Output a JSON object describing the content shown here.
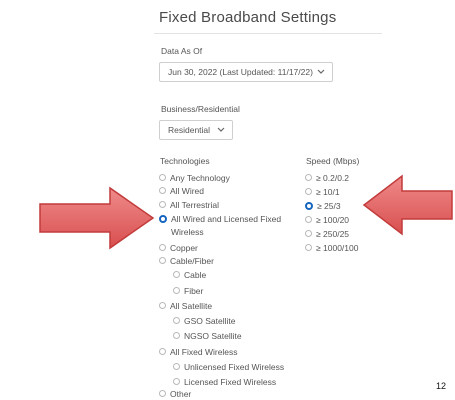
{
  "panel": {
    "title": "Fixed Broadband Settings"
  },
  "data_as_of": {
    "label": "Data As Of",
    "value": "Jun 30, 2022 (Last Updated: 11/17/22)"
  },
  "business_residential": {
    "label": "Business/Residential",
    "value": "Residential"
  },
  "technologies": {
    "label": "Technologies",
    "options": [
      "Any Technology",
      "All Wired",
      "All Terrestrial",
      "All Wired and Licensed Fixed",
      "Wireless",
      "Copper",
      "Cable/Fiber",
      "Cable",
      "Fiber",
      "All Satellite",
      "GSO Satellite",
      "NGSO Satellite",
      "All Fixed Wireless",
      "Unlicensed Fixed Wireless",
      "Licensed Fixed Wireless",
      "Other"
    ],
    "selected": "All Wired and Licensed Fixed Wireless"
  },
  "speed": {
    "label": "Speed (Mbps)",
    "options": [
      "≥ 0.2/0.2",
      "≥ 10/1",
      "≥ 25/3",
      "≥ 100/20",
      "≥ 250/25",
      "≥ 1000/100"
    ],
    "selected": "≥ 25/3"
  },
  "colors": {
    "radio_selected": "#1565c0",
    "arrow_fill": "#e06060",
    "arrow_stroke": "#c23b3b"
  },
  "slide": {
    "page_number": "12"
  }
}
